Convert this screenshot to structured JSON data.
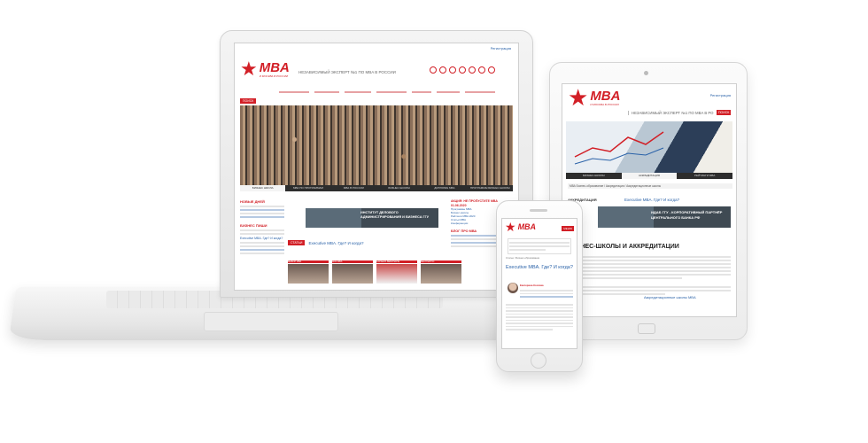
{
  "brand": {
    "logo_word": "MBA",
    "logo_sub": "И МОСКВА В РОССИИ",
    "tagline": "НЕЗАВИСИМЫЙ ЭКСПЕРТ №1 ПО MBA В РОССИИ",
    "tagline_short": "НЕЗАВИСИМЫЙ ЭКСПЕРТ №1 ПО MBA В РО",
    "accent": "#d21f26",
    "star": "★"
  },
  "laptop": {
    "top_link": "Регистрация",
    "search_label": "ПОИСК",
    "hero_tabs": [
      "БИЗНЕС ШКОЛА",
      "МВА ПО ПРОГРАММАМ",
      "МВА В РОССИИ",
      "БИЗНЕС ШКОЛЫ",
      "ДИПЛОМЫ MBA",
      "ПРОГРАММЫ БИЗНЕС ШКОЛЫ"
    ],
    "left_news_title": "НОВЫЕ ДНЕЙ",
    "left_block_title": "БИЗНЕС ПИШИ",
    "left_link": "Executive MBA. Где? И когда?",
    "promo_banner": "ИНСТИТУТ ДЕЛОВОГО АДМИНИСТРИРОВАНИЯ И БИЗНЕСА ГГУ",
    "section_title": "СТАТЬИ",
    "section_link": "Executive MBA. Где? И когда?",
    "right_title": "АКЦИЯ: НЕ ПРОПУСТИТЕ MBA 01.06.2020",
    "right_links": [
      "Программы MBA",
      "Бизнес-школы",
      "Рейтинги MBA 2020",
      "Статьи MBA",
      "Конференции"
    ],
    "right_blog_title": "БЛОГ ПРО МВА",
    "card_captions": [
      "ВЫБОР МВА",
      "MINI MBA",
      "КАРЬЕРА ВЕБИНАРЫ",
      "БЕСПЛАТНО"
    ]
  },
  "tablet": {
    "top_link": "Регистрация",
    "search_label": "ПОИСК",
    "hero_tabs": [
      "БИЗНЕС-ШКОЛЫ",
      "АККРЕДИТАЦИЯ",
      "РЕЙТИНГИ MBA"
    ],
    "breadcrumb": "МВА Бизнес-образование / Аккредитация / Аккредитационные школы",
    "side_label": "АККРЕДИТАЦИЯ",
    "promo_link": "Executive MBA. Где? И когда?",
    "promo_banner": "ИДАБ ГГУ - КОРПОРАТИВНЫЙ ПАРТНЁР ЦЕНТРАЛЬНОГО БАНКА РФ",
    "heading": "БИЗНЕС-ШКОЛЫ И АККРЕДИТАЦИИ",
    "bottom_link": "Аккредитационные школы MBA"
  },
  "phone": {
    "menu_label": "МЕНЮ",
    "breadcrumb": "Статьи / Бизнес-образование",
    "article_title": "Executive MBA. Где? И когда?",
    "author": "Екатерина Козлова"
  }
}
